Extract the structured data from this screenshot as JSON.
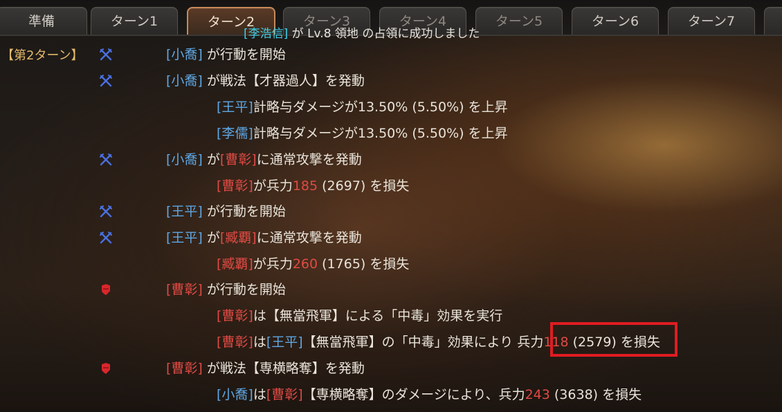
{
  "tabs": [
    "準備",
    "ターン1",
    "ターン2",
    "ターン3",
    "ターン4",
    "ターン5",
    "ターン6",
    "ターン7"
  ],
  "notice": {
    "name": "[李浩信]",
    "text": "が Lv.8 領地 の占領に成功しました"
  },
  "turn_label": "【第2ターン】",
  "log": [
    {
      "icon": "crossed-swords-icon",
      "parts": [
        {
          "t": "[小喬]",
          "c": "blue"
        },
        {
          "t": " が行動を開始",
          "c": ""
        }
      ]
    },
    {
      "icon": "crossed-swords-icon",
      "parts": [
        {
          "t": "[小喬]",
          "c": "blue"
        },
        {
          "t": " が戦法【才器過人】を発動",
          "c": ""
        }
      ]
    },
    {
      "icon": "",
      "parts": [
        {
          "t": "[王平]",
          "c": "blue"
        },
        {
          "t": "計略与ダメージが13.50% (5.50%) を上昇",
          "c": ""
        }
      ]
    },
    {
      "icon": "",
      "parts": [
        {
          "t": "[李儒]",
          "c": "blue"
        },
        {
          "t": "計略与ダメージが13.50% (5.50%) を上昇",
          "c": ""
        }
      ]
    },
    {
      "icon": "crossed-swords-icon",
      "parts": [
        {
          "t": "[小喬]",
          "c": "blue"
        },
        {
          "t": " が",
          "c": ""
        },
        {
          "t": "[曹彰]",
          "c": "red"
        },
        {
          "t": "に通常攻撃を発動",
          "c": ""
        }
      ]
    },
    {
      "icon": "",
      "parts": [
        {
          "t": "[曹彰]",
          "c": "red"
        },
        {
          "t": "が兵力",
          "c": ""
        },
        {
          "t": "185",
          "c": "red"
        },
        {
          "t": " (2697) を損失",
          "c": ""
        }
      ]
    },
    {
      "icon": "crossed-swords-icon",
      "parts": [
        {
          "t": "[王平]",
          "c": "blue"
        },
        {
          "t": " が行動を開始",
          "c": ""
        }
      ]
    },
    {
      "icon": "crossed-swords-icon",
      "parts": [
        {
          "t": "[王平]",
          "c": "blue"
        },
        {
          "t": " が",
          "c": ""
        },
        {
          "t": "[臧覇]",
          "c": "red"
        },
        {
          "t": "に通常攻撃を発動",
          "c": ""
        }
      ]
    },
    {
      "icon": "",
      "parts": [
        {
          "t": "[臧覇]",
          "c": "red"
        },
        {
          "t": "が兵力",
          "c": ""
        },
        {
          "t": "260",
          "c": "red"
        },
        {
          "t": " (1765) を損失",
          "c": ""
        }
      ]
    },
    {
      "icon": "shield-icon",
      "parts": [
        {
          "t": "[曹彰]",
          "c": "red"
        },
        {
          "t": " が行動を開始",
          "c": ""
        }
      ]
    },
    {
      "icon": "",
      "parts": [
        {
          "t": "[曹彰]",
          "c": "red"
        },
        {
          "t": "は【無當飛軍】による「中毒」効果を実行",
          "c": ""
        }
      ]
    },
    {
      "icon": "",
      "parts": [
        {
          "t": "[曹彰]",
          "c": "red"
        },
        {
          "t": "は",
          "c": ""
        },
        {
          "t": "[王平]",
          "c": "blue"
        },
        {
          "t": "【無當飛軍】の「中毒」効果により 兵力",
          "c": ""
        },
        {
          "t": "118",
          "c": "red"
        },
        {
          "t": " (2579) を損失",
          "c": ""
        }
      ]
    },
    {
      "icon": "shield-icon",
      "parts": [
        {
          "t": "[曹彰]",
          "c": "red"
        },
        {
          "t": " が戦法【専横略奪】を発動",
          "c": ""
        }
      ]
    },
    {
      "icon": "",
      "parts": [
        {
          "t": "[小喬]",
          "c": "blue"
        },
        {
          "t": "は",
          "c": ""
        },
        {
          "t": "[曹彰]",
          "c": "red"
        },
        {
          "t": "【専横略奪】のダメージにより、兵力",
          "c": ""
        },
        {
          "t": "243",
          "c": "red"
        },
        {
          "t": " (3638) を損失",
          "c": ""
        }
      ]
    }
  ],
  "colors": {
    "blue": "#5ea8e6",
    "red": "#e04a44",
    "notice_name": "#3fd0e8",
    "turn_label": "#e2b86a",
    "highlight": "#e01c22"
  }
}
